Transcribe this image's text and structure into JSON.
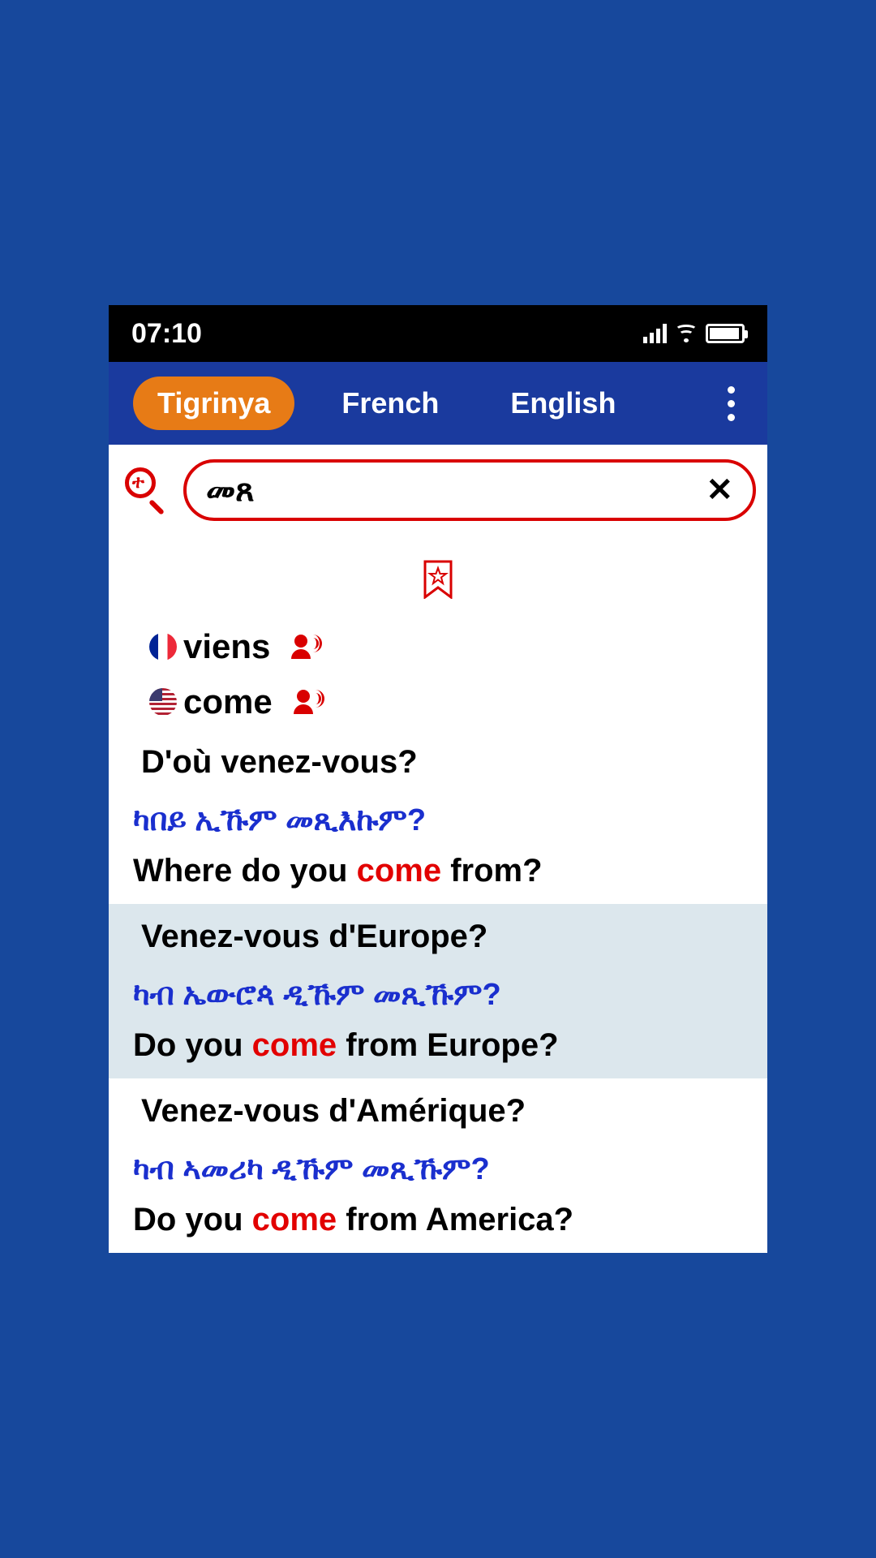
{
  "status": {
    "time": "07:10"
  },
  "tabs": {
    "t0": "Tigrinya",
    "t1": "French",
    "t2": "English"
  },
  "search": {
    "value": "መጸ",
    "icon_letter": "ተ"
  },
  "translations": {
    "fr": "viens",
    "en": "come"
  },
  "examples": [
    {
      "fr": "D'où venez-vous?",
      "ti": "ካበይ ኢኹም መጺእኩም?",
      "en_pre": "Where do you ",
      "en_hl": "come",
      "en_post": " from?"
    },
    {
      "fr": "Venez-vous d'Europe?",
      "ti": "ካብ ኤውሮጳ ዲኹም መጺኹም?",
      "en_pre": "Do you ",
      "en_hl": "come",
      "en_post": " from Europe?"
    },
    {
      "fr": "Venez-vous d'Amérique?",
      "ti": "ካብ ኣመሪካ ዲኹም መጺኹም?",
      "en_pre": "Do you ",
      "en_hl": "come",
      "en_post": " from America?"
    }
  ]
}
